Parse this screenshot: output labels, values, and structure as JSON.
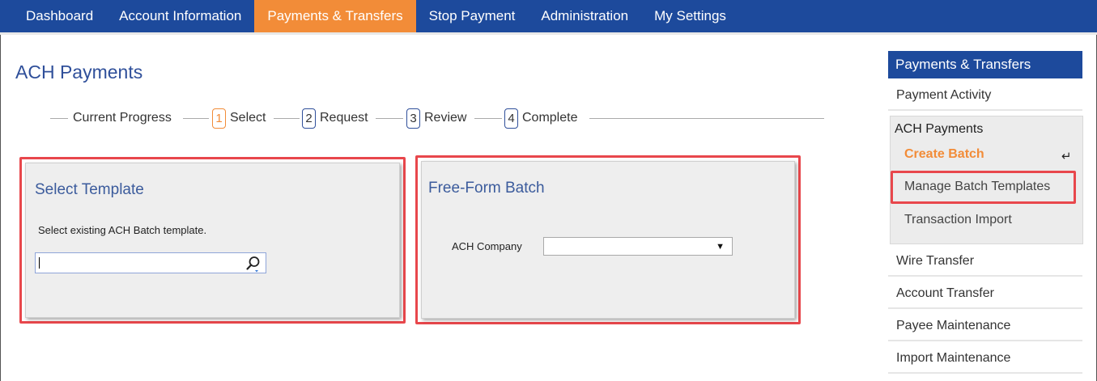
{
  "topnav": {
    "items": [
      {
        "label": "Dashboard"
      },
      {
        "label": "Account Information"
      },
      {
        "label": "Payments & Transfers"
      },
      {
        "label": "Stop Payment"
      },
      {
        "label": "Administration"
      },
      {
        "label": "My Settings"
      }
    ],
    "active_index": 2
  },
  "page": {
    "title": "ACH Payments"
  },
  "progress": {
    "label": "Current Progress",
    "steps": [
      {
        "num": "1",
        "label": "Select"
      },
      {
        "num": "2",
        "label": "Request"
      },
      {
        "num": "3",
        "label": "Review"
      },
      {
        "num": "4",
        "label": "Complete"
      }
    ]
  },
  "select_template": {
    "title": "Select Template",
    "description": "Select existing ACH Batch template.",
    "input_value": "",
    "icon": "search-icon"
  },
  "free_form": {
    "title": "Free-Form Batch",
    "company_label": "ACH Company",
    "company_value": ""
  },
  "sidebar": {
    "header": "Payments & Transfers",
    "payment_activity": "Payment Activity",
    "ach_group": {
      "title": "ACH Payments",
      "create_batch": "Create Batch",
      "manage_templates": "Manage Batch Templates",
      "transaction_import": "Transaction Import"
    },
    "links": [
      {
        "label": "Wire Transfer"
      },
      {
        "label": "Account Transfer"
      },
      {
        "label": "Payee Maintenance"
      },
      {
        "label": "Import Maintenance"
      }
    ]
  },
  "colors": {
    "nav_blue": "#1d4a9c",
    "accent_orange": "#f28c38",
    "highlight_red": "#e8474c"
  }
}
